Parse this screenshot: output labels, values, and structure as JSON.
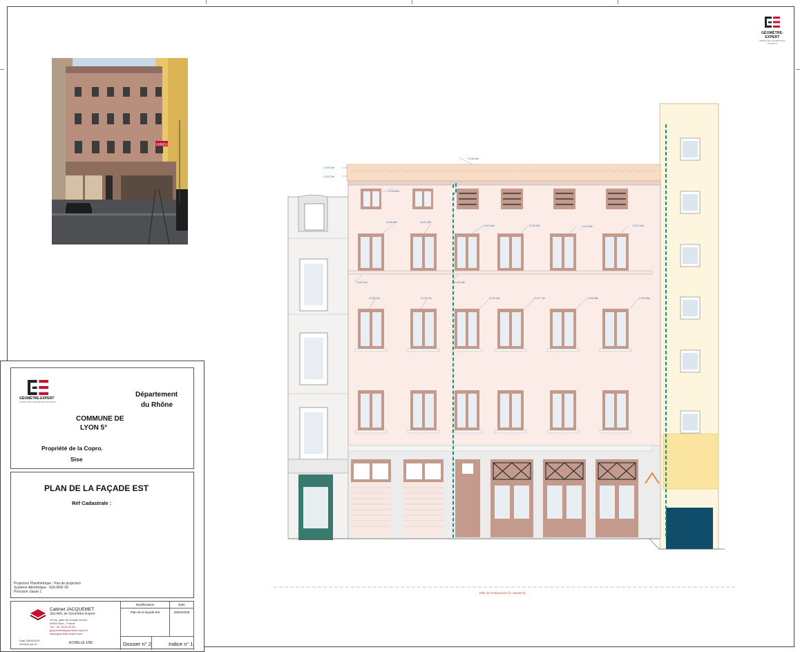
{
  "header": {
    "logo_label": "GÉOMÈTRE-EXPERT",
    "logo_sub": "ORDRE DES GÉOMÈTRES-EXPERTS"
  },
  "photo": {
    "sign_text": "VENDU"
  },
  "cartouche": {
    "department_line1": "Département",
    "department_line2": "du Rhône",
    "commune_line1": "COMMUNE DE",
    "commune_line2": "LYON 5°",
    "property": "Propriété de la Copro.",
    "sise": "Sise",
    "plan_title": "PLAN DE LA FAÇADE EST",
    "ref_cadastrale": "Réf Cadastrale :",
    "projection": [
      "Projection Planimétrique : Pas de projection",
      "Système Altimétrique : IGN NGF 69",
      "Précision classe 1"
    ],
    "cabinet_name": "Cabinet JACQUEMET",
    "cabinet_sub": "SELARL de Géomètre-Expert",
    "cabinet_address": [
      "29 bis, allée de Grande-Roche",
      "69500 Bron - France",
      "Tél. : 04 78 26 42 56",
      "jacquemet@geometre-expert.fr",
      "www.geometre-expert.com"
    ],
    "table_headers": {
      "modifications": "Modifications",
      "date": "Date"
    },
    "table_rows": [
      {
        "modification": "Plan de la façade Est",
        "date": "28/04/2025"
      }
    ],
    "date_line": "Date 28/04/2025",
    "drawn_by": "dessiné par EL",
    "echelle": "ECHELLE 1/50",
    "dossier": "Dossier n° 2",
    "indice": "Indice n° 1"
  },
  "drawing": {
    "comparison_label": "Plan de Comparaison (Z=166.00 m)",
    "colors": {
      "facade": "#fcece8",
      "frame": "#c49a8c",
      "green_door": "#3a7a6e",
      "blue_door": "#0f4d6b",
      "yellow": "#fbe9b0",
      "roof": "#f5d3b2",
      "dashed": "#159184"
    },
    "elevations": [
      "Z=225.18m",
      "Z=220.39m",
      "Z=218.25m",
      "Z=218.82m",
      "Z=218.89m",
      "Z=221.06m",
      "Z=221.64m",
      "Z=219.39m",
      "Z=222.53m",
      "Z=217.16m",
      "Z=220.01m",
      "Z=219.28m",
      "Z=220.70m",
      "Z=212.73m",
      "Z=213.52m",
      "Z=217.70m",
      "Z=218.35m",
      "Z=213.68m"
    ]
  }
}
